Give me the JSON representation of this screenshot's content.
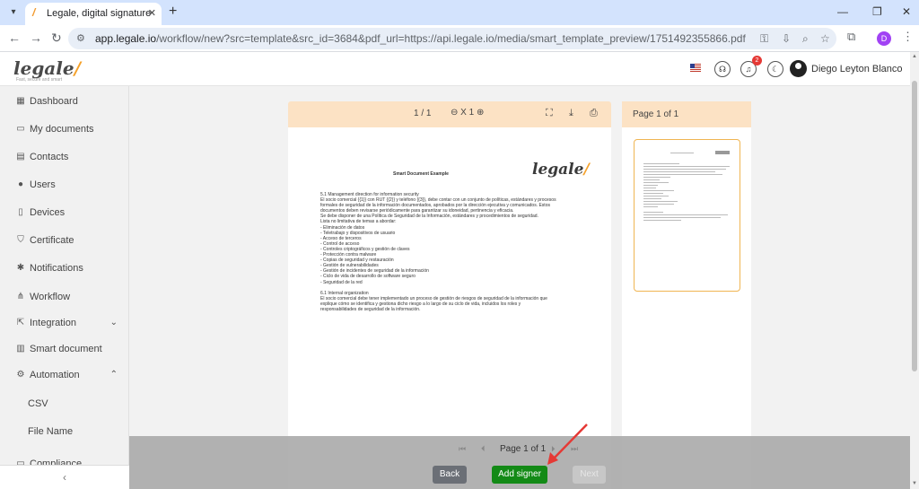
{
  "browser": {
    "tab_title": "Legale, digital signature",
    "url_host": "app.legale.io",
    "url_rest": "/workflow/new?src=template&src_id=3684&pdf_url=https://api.legale.io/media/smart_template_preview/1751492355866.pdf",
    "profile_initial": "D"
  },
  "header": {
    "logo": "legale",
    "logo_tagline": "Fast, secure and smart",
    "notification_count": "2",
    "user_name": "Diego Leyton Blanco"
  },
  "sidebar": {
    "items": [
      {
        "label": "Dashboard",
        "icon": "dashboard-icon"
      },
      {
        "label": "My documents",
        "icon": "folder-icon"
      },
      {
        "label": "Contacts",
        "icon": "contacts-icon"
      },
      {
        "label": "Users",
        "icon": "user-icon"
      },
      {
        "label": "Devices",
        "icon": "device-icon"
      },
      {
        "label": "Certificate",
        "icon": "shield-icon"
      },
      {
        "label": "Notifications",
        "icon": "bell-icon"
      },
      {
        "label": "Workflow",
        "icon": "workflow-icon"
      },
      {
        "label": "Integration",
        "icon": "integration-icon"
      },
      {
        "label": "Smart document",
        "icon": "smart-document-icon"
      },
      {
        "label": "Automation",
        "icon": "automation-icon"
      }
    ],
    "sub_items": [
      "CSV",
      "File Name"
    ],
    "partial_item": "Compliance"
  },
  "viewer": {
    "page_indicator": "1 / 1",
    "zoom": "X 1"
  },
  "document": {
    "title": "Smart Document Example",
    "logo": "legale",
    "lines": [
      "5.1 Management direction for information security",
      "El socio comercial {{1}} con RUT {{2}} y teléfono {{3}}, debe contar con un conjunto de políticas, estándares y procesos",
      "formales de seguridad de la información documentados, aprobados por la dirección ejecutiva y comunicados. Estos",
      "documentos deben revisarse periódicamente para garantizar su idoneidad, pertinencia y eficacia.",
      "Se debe disponer de una Política de Seguridad de la Información, estándares y procedimientos de seguridad.",
      "Lista no limitativa de temas a abordar:",
      "- Eliminación de datos",
      "- Teletrabajo y dispositivos de usuario",
      "- Acceso de terceros",
      "- Control de acceso",
      "- Controles criptográficos y gestión de claves",
      "- Protección contra malware",
      "- Copias de seguridad y restauración",
      "- Gestión de vulnerabilidades",
      "- Gestión de incidentes de seguridad de la información",
      "- Ciclo de vida de desarrollo de software seguro",
      "- Seguridad de la red",
      "",
      "6.1 Internal organization",
      "El socio comercial debe tener implementado un proceso de gestión de riesgos de seguridad de la información que",
      "explique cómo se identifica y gestiona dicho riesgo a lo largo de su ciclo de vida, incluidos los roles y",
      "responsabilidades de seguridad de la información."
    ]
  },
  "thumbnails": {
    "title": "Page 1 of 1"
  },
  "footer": {
    "pager_text": "Page 1 of 1",
    "back_label": "Back",
    "add_signer_label": "Add signer",
    "next_label": "Next"
  },
  "colors": {
    "accent_orange": "#f5a12a",
    "viewer_header": "#fce2c4",
    "add_signer_green": "#138a16",
    "annotation_arrow": "#e53935"
  }
}
